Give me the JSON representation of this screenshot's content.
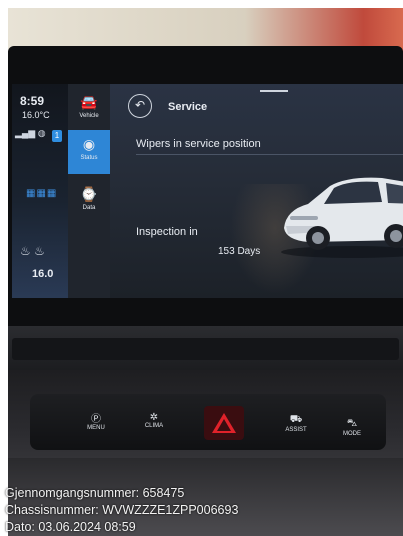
{
  "screen": {
    "time": "8:59",
    "outside_temp": "16.0",
    "outside_temp_unit": "°C",
    "seat_temp": "16.0",
    "status_badge": "1",
    "nav": [
      {
        "label": "Vehicle",
        "icon": "car-icon"
      },
      {
        "label": "Status",
        "icon": "status-icon"
      },
      {
        "label": "Data",
        "icon": "data-icon"
      }
    ],
    "page_title": "Service",
    "wipers_item": "Wipers in service position",
    "inspection_label": "Inspection in",
    "inspection_days": "153 Days"
  },
  "console": {
    "menu_label": "MENU",
    "clima_label": "CLIMA",
    "assist_label": "ASSIST",
    "mode_label": "MODE"
  },
  "caption": {
    "line1": "Gjennomgangsnummer: 658475",
    "line2": "Chassisnummer: WVWZZZE1ZPP006693",
    "line3": "Dato: 03.06.2024 08:59"
  },
  "colors": {
    "accent": "#2e86d6",
    "hazard": "#e0222a"
  }
}
